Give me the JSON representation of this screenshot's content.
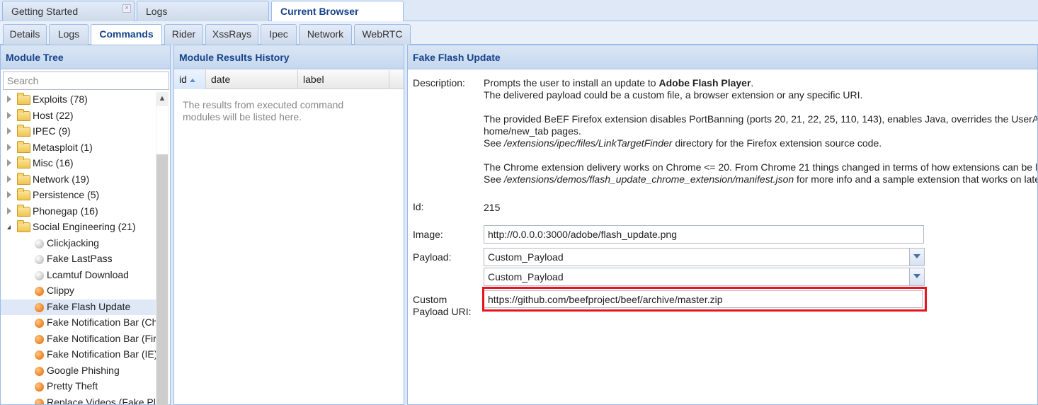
{
  "top_tabs": [
    {
      "label": "Getting Started",
      "closable": true
    },
    {
      "label": "Logs"
    },
    {
      "label": "Current Browser",
      "active": true
    }
  ],
  "sub_tabs": [
    "Details",
    "Logs",
    "Commands",
    "Rider",
    "XssRays",
    "Ipec",
    "Network",
    "WebRTC"
  ],
  "active_sub_tab": "Commands",
  "module_tree": {
    "title": "Module Tree",
    "search_placeholder": "Search",
    "categories": [
      {
        "label": "Exploits (78)"
      },
      {
        "label": "Host (22)"
      },
      {
        "label": "IPEC (9)"
      },
      {
        "label": "Metasploit (1)"
      },
      {
        "label": "Misc (16)"
      },
      {
        "label": "Network (19)"
      },
      {
        "label": "Persistence (5)"
      },
      {
        "label": "Phonegap (16)"
      },
      {
        "label": "Social Engineering (21)",
        "expanded": true
      }
    ],
    "modules": [
      {
        "label": "Clickjacking",
        "status": "grey"
      },
      {
        "label": "Fake LastPass",
        "status": "grey"
      },
      {
        "label": "Lcamtuf Download",
        "status": "grey"
      },
      {
        "label": "Clippy",
        "status": "orange"
      },
      {
        "label": "Fake Flash Update",
        "status": "orange",
        "selected": true
      },
      {
        "label": "Fake Notification Bar (Chrome)",
        "status": "orange"
      },
      {
        "label": "Fake Notification Bar (Firefox)",
        "status": "orange"
      },
      {
        "label": "Fake Notification Bar (IE)",
        "status": "orange"
      },
      {
        "label": "Google Phishing",
        "status": "orange"
      },
      {
        "label": "Pretty Theft",
        "status": "orange"
      },
      {
        "label": "Replace Videos (Fake Plugin)",
        "status": "orange"
      }
    ]
  },
  "results_history": {
    "title": "Module Results History",
    "columns": [
      "id",
      "date",
      "label"
    ],
    "empty_message": "The results from executed command modules will be listed here."
  },
  "module_detail": {
    "title": "Fake Flash Update",
    "description_label": "Description:",
    "description_line1_pre": "Prompts the user to install an update to ",
    "description_line1_bold": "Adobe Flash Player",
    "description_line1_post": ".",
    "description_line2": "The delivered payload could be a custom file, a browser extension or any specific URI.",
    "description_line3": "The provided BeEF Firefox extension disables PortBanning (ports 20, 21, 22, 25, 110, 143), enables Java, overrides the UserAgen",
    "description_line4": "home/new_tab pages.",
    "description_line5_pre": "See ",
    "description_line5_path": "/extensions/ipec/files/LinkTargetFinder",
    "description_line5_post": " directory for the Firefox extension source code.",
    "description_line6": "The Chrome extension delivery works on Chrome <= 20. From Chrome 21 things changed in terms of how extensions can be lo",
    "description_line7_pre": "See ",
    "description_line7_path": "/extensions/demos/flash_update_chrome_extension/manifest.json",
    "description_line7_post": " for more info and a sample extension that works on lates",
    "id_label": "Id:",
    "id_value": "215",
    "image_label": "Image:",
    "image_value": "http://0.0.0.0:3000/adobe/flash_update.png",
    "payload_label": "Payload:",
    "payload_value_1": "Custom_Payload",
    "payload_value_2": "Custom_Payload",
    "custom_uri_label_1": "Custom",
    "custom_uri_label_2": "Payload URI:",
    "custom_uri_value": "https://github.com/beefproject/beef/archive/master.zip",
    "highlight_color": "#e8141a"
  }
}
